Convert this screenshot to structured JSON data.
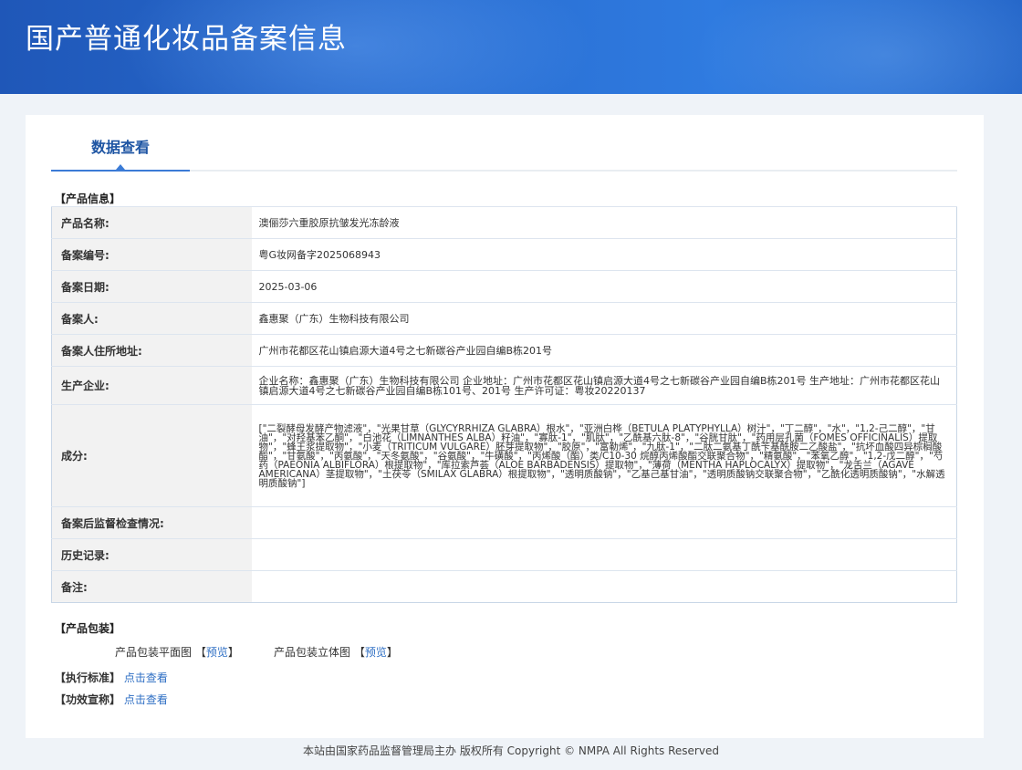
{
  "header": {
    "site_title": "国产普通化妆品备案信息"
  },
  "tabs": {
    "active_label": "数据查看"
  },
  "product_info": {
    "section_title": "【产品信息】",
    "rows": [
      {
        "label": "产品名称:",
        "value": "澳俪莎六重胶原抗皱发光冻龄液"
      },
      {
        "label": "备案编号:",
        "value": "粤G妆网备字2025068943"
      },
      {
        "label": "备案日期:",
        "value": "2025-03-06"
      },
      {
        "label": "备案人:",
        "value": "鑫惠聚（广东）生物科技有限公司"
      },
      {
        "label": "备案人住所地址:",
        "value": "广州市花都区花山镇启源大道4号之七新碳谷产业园自编B栋201号"
      },
      {
        "label": "生产企业:",
        "value": "企业名称：鑫惠聚（广东）生物科技有限公司 企业地址：广州市花都区花山镇启源大道4号之七新碳谷产业园自编B栋201号 生产地址：广州市花都区花山镇启源大道4号之七新碳谷产业园自编B栋101号、201号 生产许可证：粤妆20220137"
      },
      {
        "label": "成分:",
        "value": "[\"二裂酵母发酵产物滤液\"，\"光果甘草（GLYCYRRHIZA GLABRA）根水\"，\"亚洲白桦（BETULA PLATYPHYLLA）树汁\"，\"丁二醇\"，\"水\"，\"1,2-己二醇\"，\"甘油\"，\"对羟基苯乙酮\"，\"白池花（LIMNANTHES ALBA）籽油\"，\"寡肽-1\"，\"肌肽\"，\"乙酰基六肽-8\"，\"谷胱甘肽\"，\"药用层孔菌（FOMES OFFICINALIS）提取物\"，\"蜂王浆提取物\"，\"小麦（TRITICUM VULGARE）胚芽提取物\"，\"胶原\"，\"富勒烯\"，\"九肽-1\"，\"二肽二氨基丁酰苄基酰胺二乙酸盐\"，\"抗坏血酸四异棕榈酸酯\"，\"甘氨酸\"，\"丙氨酸\"，\"天冬氨酸\"，\"谷氨酸\"，\"牛磺酸\"，\"丙烯酸（酯）类/C10-30 烷醇丙烯酸酯交联聚合物\"，\"精氨酸\"，\"苯氧乙醇\"，\"1,2-戊二醇\"，\"芍药（PAEONIA ALBIFLORA）根提取物\"，\"库拉索芦荟（ALOE BARBADENSIS）提取物\"，\"薄荷（MENTHA HAPLOCALYX）提取物\"，\"龙舌兰（AGAVE AMERICANA）茎提取物\"，\"土茯苓（SMILAX GLABRA）根提取物\"，\"透明质酸钠\"，\"乙基己基甘油\"，\"透明质酸钠交联聚合物\"，\"乙酰化透明质酸钠\"，\"水解透明质酸钠\"]"
      },
      {
        "label": "备案后监督检查情况:",
        "value": ""
      },
      {
        "label": "历史记录:",
        "value": ""
      },
      {
        "label": "备注:",
        "value": ""
      }
    ]
  },
  "packaging": {
    "section_title": "【产品包装】",
    "flat_label": "产品包装平面图",
    "stereo_label": "产品包装立体图",
    "bracket_open": "【",
    "bracket_close": "】",
    "preview_link": "预览"
  },
  "standards": {
    "label": "【执行标准】",
    "link": "点击查看"
  },
  "efficacy": {
    "label": "【功效宣称】",
    "link": "点击查看"
  },
  "footer": {
    "text": "本站由国家药品监督管理局主办 版权所有 Copyright © NMPA All Rights Reserved"
  }
}
